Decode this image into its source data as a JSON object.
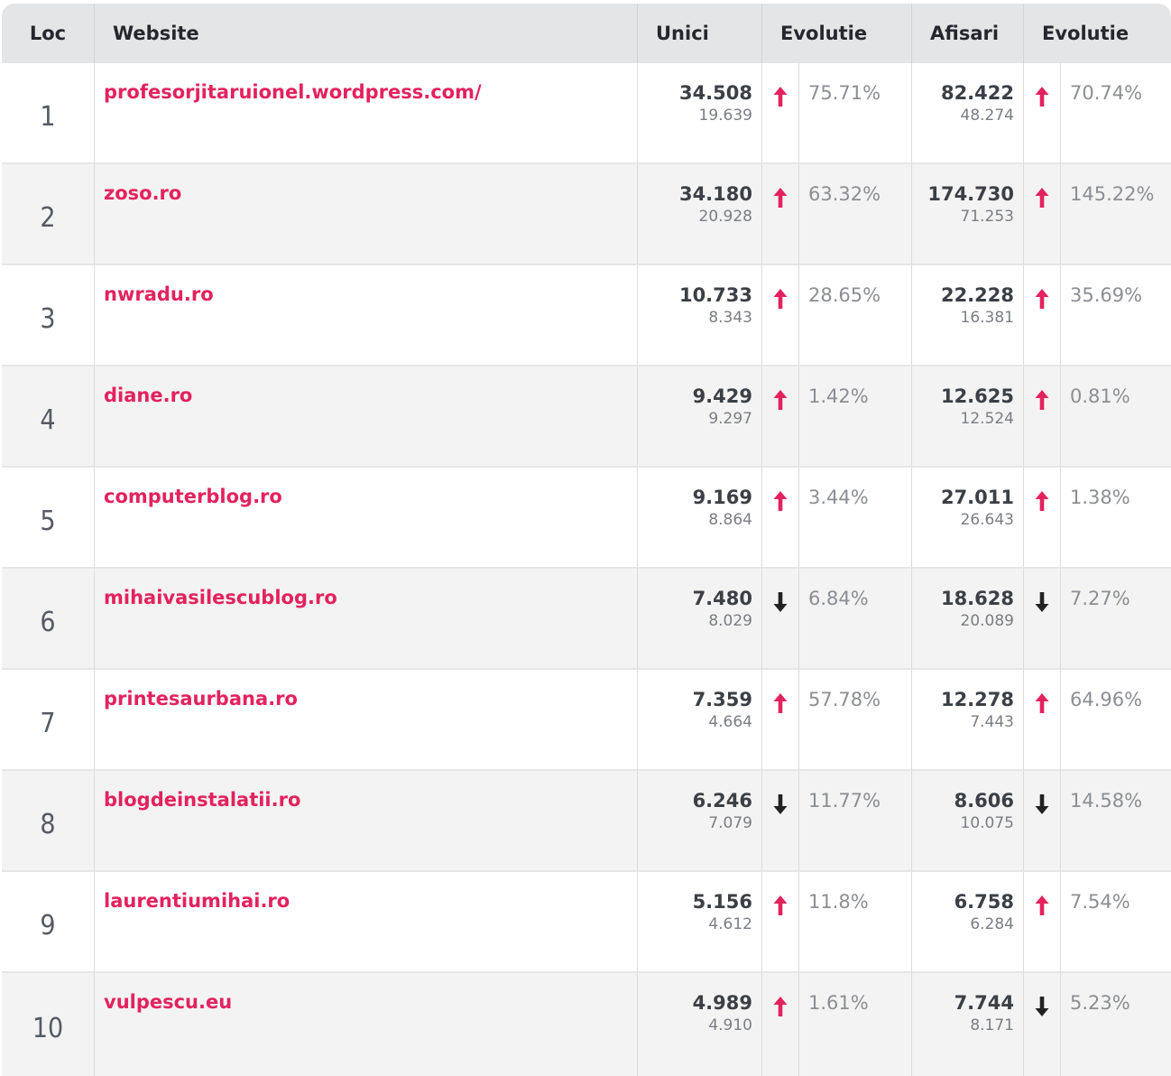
{
  "header": {
    "loc": "Loc",
    "website": "Website",
    "unici": "Unici",
    "evolutie_unici": "Evolutie",
    "afisari": "Afisari",
    "evolutie_afisari": "Evolutie"
  },
  "colors": {
    "accent": "#e3225e",
    "down": "#222222",
    "header_bg": "#e4e5e6"
  },
  "rows": [
    {
      "loc": "1",
      "site": "profesorjitaruionel.wordpress.com/",
      "unici": "34.508",
      "unici_prev": "19.639",
      "unici_dir": "up",
      "unici_pct": "75.71%",
      "afisari": "82.422",
      "afisari_prev": "48.274",
      "afisari_dir": "up",
      "afisari_pct": "70.74%"
    },
    {
      "loc": "2",
      "site": "zoso.ro",
      "unici": "34.180",
      "unici_prev": "20.928",
      "unici_dir": "up",
      "unici_pct": "63.32%",
      "afisari": "174.730",
      "afisari_prev": "71.253",
      "afisari_dir": "up",
      "afisari_pct": "145.22%"
    },
    {
      "loc": "3",
      "site": "nwradu.ro",
      "unici": "10.733",
      "unici_prev": "8.343",
      "unici_dir": "up",
      "unici_pct": "28.65%",
      "afisari": "22.228",
      "afisari_prev": "16.381",
      "afisari_dir": "up",
      "afisari_pct": "35.69%"
    },
    {
      "loc": "4",
      "site": "diane.ro",
      "unici": "9.429",
      "unici_prev": "9.297",
      "unici_dir": "up",
      "unici_pct": "1.42%",
      "afisari": "12.625",
      "afisari_prev": "12.524",
      "afisari_dir": "up",
      "afisari_pct": "0.81%"
    },
    {
      "loc": "5",
      "site": "computerblog.ro",
      "unici": "9.169",
      "unici_prev": "8.864",
      "unici_dir": "up",
      "unici_pct": "3.44%",
      "afisari": "27.011",
      "afisari_prev": "26.643",
      "afisari_dir": "up",
      "afisari_pct": "1.38%"
    },
    {
      "loc": "6",
      "site": "mihaivasilescublog.ro",
      "unici": "7.480",
      "unici_prev": "8.029",
      "unici_dir": "down",
      "unici_pct": "6.84%",
      "afisari": "18.628",
      "afisari_prev": "20.089",
      "afisari_dir": "down",
      "afisari_pct": "7.27%"
    },
    {
      "loc": "7",
      "site": "printesaurbana.ro",
      "unici": "7.359",
      "unici_prev": "4.664",
      "unici_dir": "up",
      "unici_pct": "57.78%",
      "afisari": "12.278",
      "afisari_prev": "7.443",
      "afisari_dir": "up",
      "afisari_pct": "64.96%"
    },
    {
      "loc": "8",
      "site": "blogdeinstalatii.ro",
      "unici": "6.246",
      "unici_prev": "7.079",
      "unici_dir": "down",
      "unici_pct": "11.77%",
      "afisari": "8.606",
      "afisari_prev": "10.075",
      "afisari_dir": "down",
      "afisari_pct": "14.58%"
    },
    {
      "loc": "9",
      "site": "laurentiumihai.ro",
      "unici": "5.156",
      "unici_prev": "4.612",
      "unici_dir": "up",
      "unici_pct": "11.8%",
      "afisari": "6.758",
      "afisari_prev": "6.284",
      "afisari_dir": "up",
      "afisari_pct": "7.54%"
    },
    {
      "loc": "10",
      "site": "vulpescu.eu",
      "unici": "4.989",
      "unici_prev": "4.910",
      "unici_dir": "up",
      "unici_pct": "1.61%",
      "afisari": "7.744",
      "afisari_prev": "8.171",
      "afisari_dir": "down",
      "afisari_pct": "5.23%"
    }
  ]
}
